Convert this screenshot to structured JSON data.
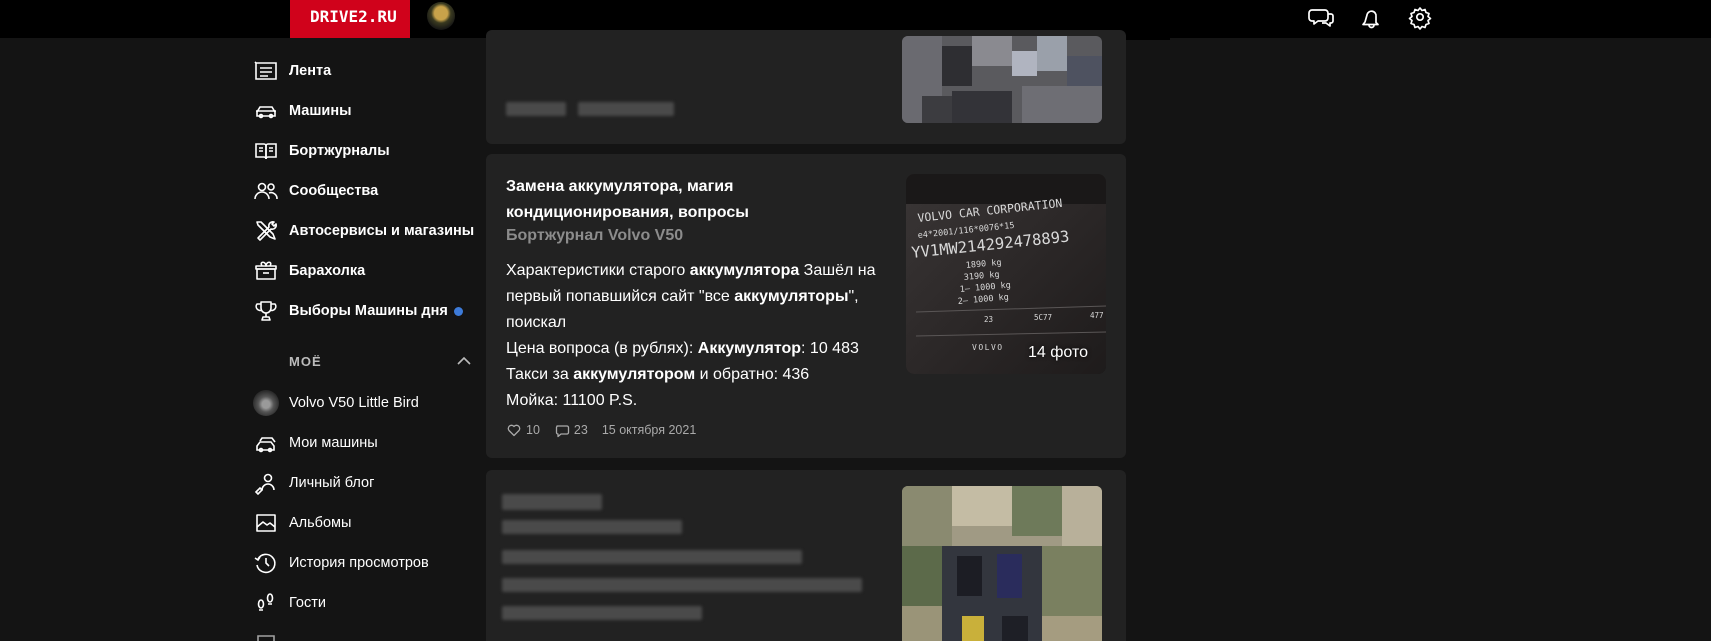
{
  "header": {
    "logo": "DRIVE2.RU"
  },
  "sidebar": {
    "items": [
      {
        "label": "Лента",
        "icon": "feed-icon"
      },
      {
        "label": "Машины",
        "icon": "car-icon"
      },
      {
        "label": "Бортжурналы",
        "icon": "book-icon"
      },
      {
        "label": "Сообщества",
        "icon": "people-icon"
      },
      {
        "label": "Автосервисы и магазины",
        "icon": "tools-icon"
      },
      {
        "label": "Барахолка",
        "icon": "box-icon"
      },
      {
        "label": "Выборы Машины дня",
        "icon": "trophy-icon"
      }
    ],
    "my_section": {
      "title": "МОЁ",
      "items": [
        {
          "label": "Volvo V50 Little Bird",
          "icon": "car-avatar"
        },
        {
          "label": "Мои машины",
          "icon": "cars-icon"
        },
        {
          "label": "Личный блог",
          "icon": "blog-icon"
        },
        {
          "label": "Альбомы",
          "icon": "album-icon"
        },
        {
          "label": "История просмотров",
          "icon": "history-icon"
        },
        {
          "label": "Гости",
          "icon": "footprints-icon"
        }
      ]
    }
  },
  "post": {
    "title": "Замена аккумулятора, магия кондиционирования, вопросы",
    "journal": "Бортжурнал Volvo V50",
    "body": [
      [
        "Характеристики старого ",
        "аккумулятора",
        " Зашёл на первый попавшийся сайт \"все ",
        "аккумуляторы",
        "\", поискал"
      ],
      [
        "Цена вопроса (в рублях): ",
        "Аккумулятор",
        ": 10 483"
      ],
      [
        "Такси за ",
        "аккумулятором",
        " и обратно: 436"
      ],
      [
        "Мойка: 11100 P.S."
      ]
    ],
    "likes": "10",
    "comments": "23",
    "date": "15 октября 2021",
    "photo_count": "14 фото",
    "plate": {
      "line1": "VOLVO CAR CORPORATION",
      "line2": "e4*2001/116*0076*15",
      "vin": "YV1MW214292478893",
      "w1": "1890 kg",
      "w2": "3190 kg",
      "w3": "1— 1000 kg",
      "w4": "2— 1000 kg",
      "c1": "23",
      "c2": "5C77",
      "c3": "477",
      "brand": "VOLVO"
    }
  }
}
